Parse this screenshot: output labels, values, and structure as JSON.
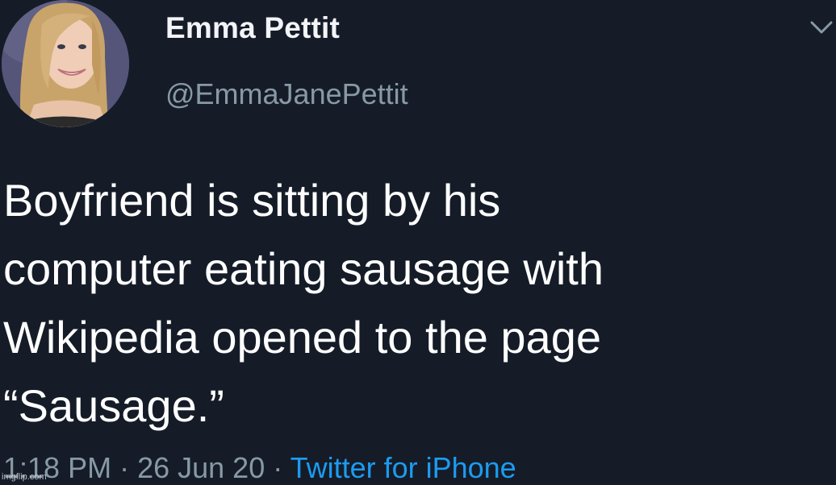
{
  "tweet": {
    "author": {
      "display_name": "Emma Pettit",
      "handle": "@EmmaJanePettit",
      "avatar_icon": "profile-photo"
    },
    "caret_icon": "chevron-down-icon",
    "text": "Boyfriend is sitting by his\ncomputer eating sausage with\nWikipedia opened to the page\n“Sausage.”",
    "meta": {
      "time": "1:18 PM",
      "separator": " · ",
      "date": "26 Jun 20",
      "source": "Twitter for iPhone"
    }
  },
  "watermark": "imgflip.com",
  "colors": {
    "background": "#151c28",
    "secondary_text": "#8899a6",
    "link": "#1d9bf0"
  }
}
